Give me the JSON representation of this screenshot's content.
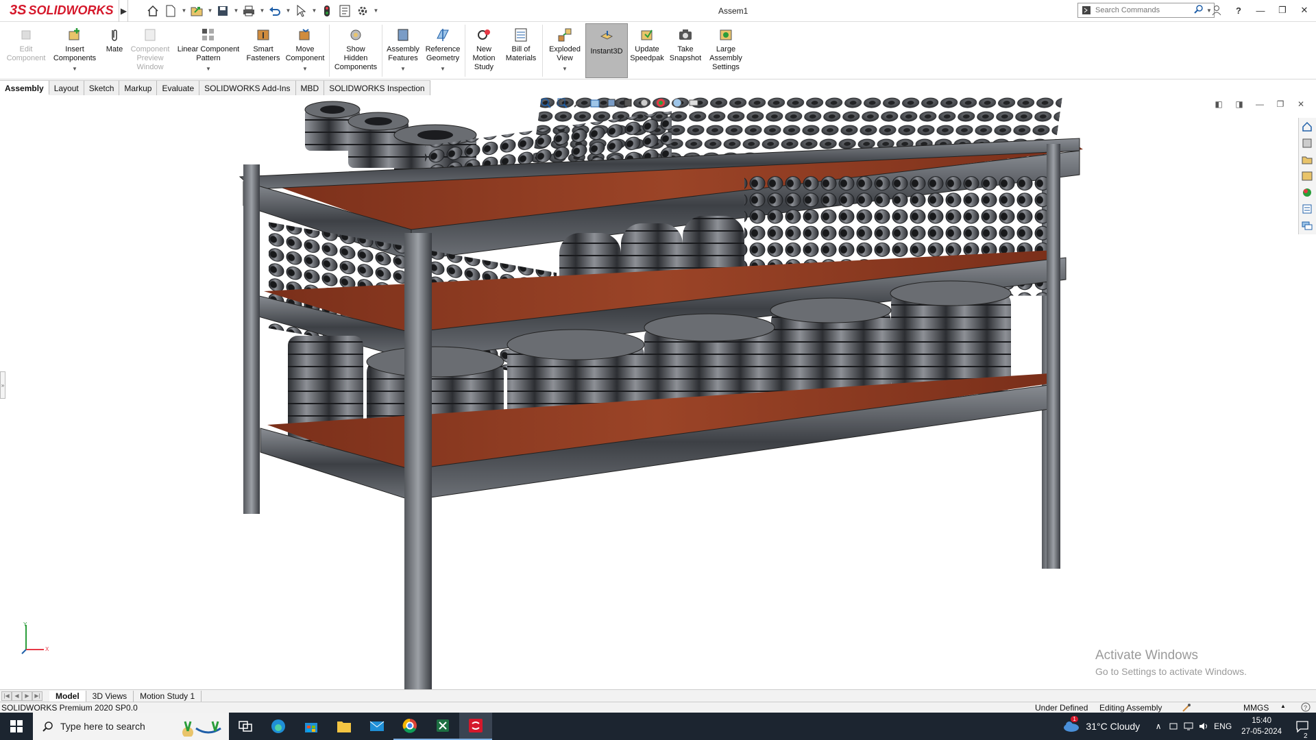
{
  "app": {
    "brand_prefix": "3S",
    "brand": "SOLIDWORKS",
    "document_title": "Assem1"
  },
  "search": {
    "placeholder": "Search Commands"
  },
  "ribbon": {
    "edit_component": "Edit Component",
    "insert_components": "Insert Components",
    "mate": "Mate",
    "component_preview": "Component Preview Window",
    "linear_pattern": "Linear Component Pattern",
    "smart_fasteners": "Smart Fasteners",
    "move_component": "Move Component",
    "show_hidden": "Show Hidden Components",
    "assembly_features": "Assembly Features",
    "reference_geometry": "Reference Geometry",
    "new_motion_study": "New Motion Study",
    "bill_of_materials": "Bill of Materials",
    "exploded_view": "Exploded View",
    "instant3d": "Instant3D",
    "update_speedpak": "Update Speedpak",
    "take_snapshot": "Take Snapshot",
    "large_assembly": "Large Assembly Settings"
  },
  "tabs": [
    "Assembly",
    "Layout",
    "Sketch",
    "Markup",
    "Evaluate",
    "SOLIDWORKS Add-Ins",
    "MBD",
    "SOLIDWORKS Inspection"
  ],
  "watermark": {
    "line1": "Activate Windows",
    "line2": "Go to Settings to activate Windows."
  },
  "bottom_tabs": [
    "Model",
    "3D Views",
    "Motion Study 1"
  ],
  "status": {
    "product": "SOLIDWORKS Premium 2020 SP0.0",
    "definition": "Under Defined",
    "mode": "Editing Assembly",
    "units": "MMGS"
  },
  "taskbar": {
    "search_placeholder": "Type here to search",
    "weather_badge": "1",
    "weather": "31°C  Cloudy",
    "language": "ENG",
    "time": "15:40",
    "date": "27-05-2024",
    "notifications": "2"
  },
  "colors": {
    "brand": "#d5182b",
    "taskbar": "#1c2530",
    "shelf_wood": "#8a3a22",
    "steel": "#4a4d52"
  }
}
